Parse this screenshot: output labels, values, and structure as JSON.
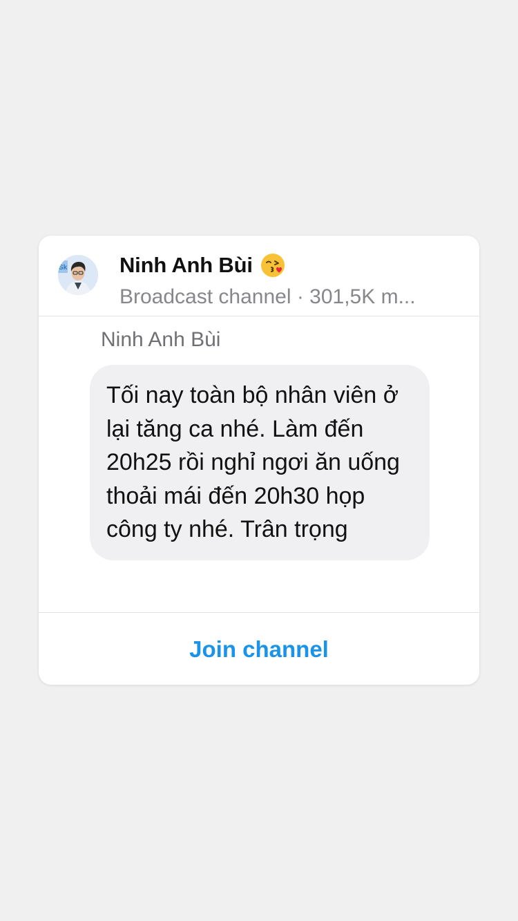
{
  "channel": {
    "name": "Ninh Anh Bùi",
    "name_emoji": "kissing-face-emoji",
    "subtitle": "Broadcast channel · 301,5K m..."
  },
  "message": {
    "sender": "Ninh Anh Bùi",
    "text": "Tối nay toàn bộ nhân viên ở lại tăng ca nhé. Làm đến 20h25 rồi nghỉ ngơi ăn uống thoải mái đến 20h30 họp công ty nhé. Trân trọng"
  },
  "actions": {
    "join_label": "Join channel"
  },
  "colors": {
    "background": "#f0f0f1",
    "accent": "#1b93e8",
    "bubble": "#f0f0f2",
    "secondary_text": "#86868b"
  }
}
